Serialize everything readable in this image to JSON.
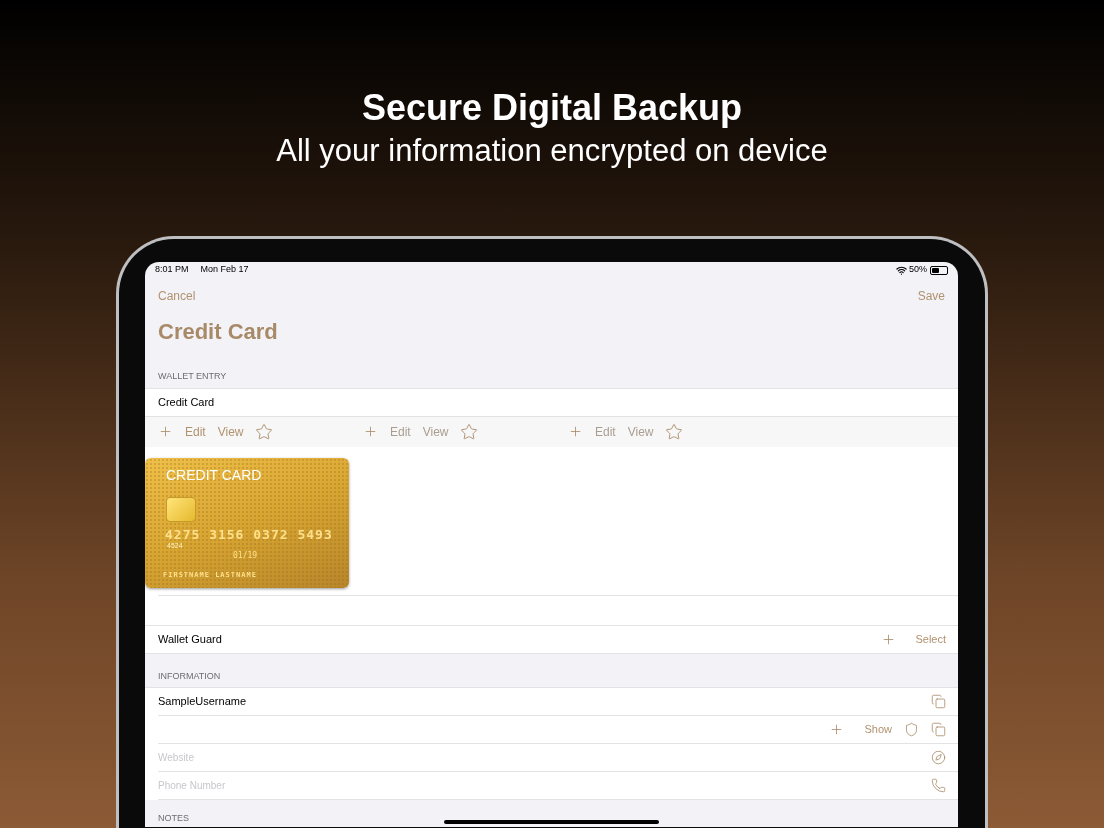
{
  "headline": {
    "title": "Secure Digital Backup",
    "subtitle": "All your information encrypted on device"
  },
  "status_bar": {
    "time": "8:01 PM",
    "date": "Mon Feb 17",
    "battery": "50%"
  },
  "nav": {
    "cancel": "Cancel",
    "save": "Save",
    "title": "Credit Card"
  },
  "wallet_entry": {
    "header": "WALLET ENTRY",
    "name": "Credit Card",
    "action_groups": [
      {
        "edit": "Edit",
        "view": "View",
        "disabled": false
      },
      {
        "edit": "Edit",
        "view": "View",
        "disabled": true
      },
      {
        "edit": "Edit",
        "view": "View",
        "disabled": true
      }
    ],
    "card": {
      "title": "CREDIT CARD",
      "number": "4275 3156 0372 5493",
      "code": "4524",
      "expiry": "01/19",
      "holder": "FIRSTNAME LASTNAME"
    }
  },
  "wallet_guard": {
    "label": "Wallet Guard",
    "select": "Select"
  },
  "information": {
    "header": "INFORMATION",
    "rows": [
      {
        "kind": "value",
        "value": "SampleUsername"
      },
      {
        "kind": "secret",
        "show": "Show"
      },
      {
        "kind": "website",
        "placeholder": "Website"
      },
      {
        "kind": "phone",
        "placeholder": "Phone Number"
      }
    ]
  },
  "notes": {
    "header": "NOTES"
  }
}
